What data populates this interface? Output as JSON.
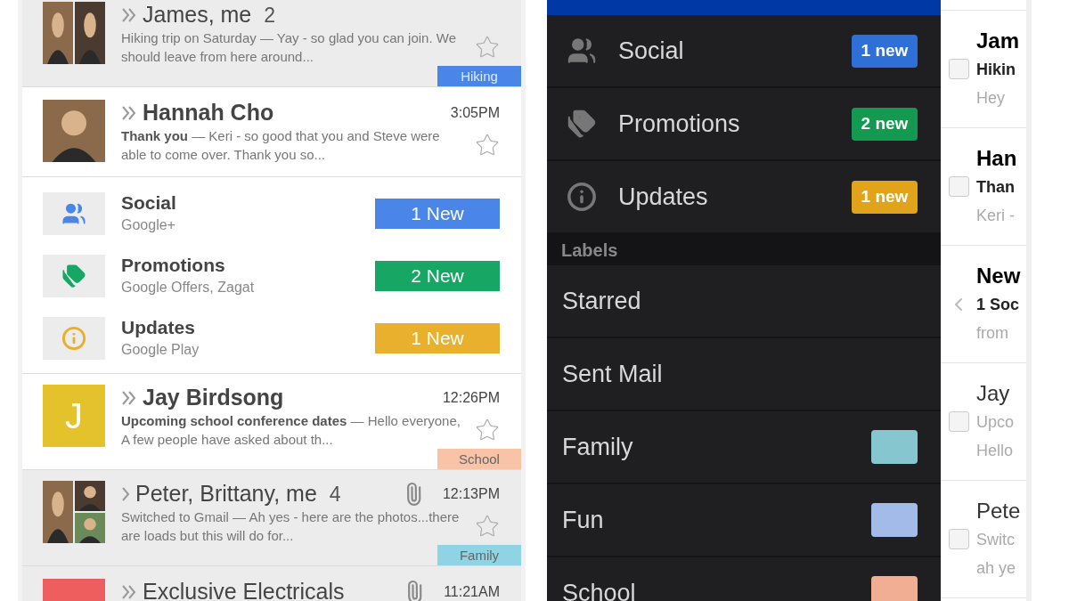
{
  "inbox": {
    "threads": [
      {
        "kind": "thread",
        "sender": "James, me",
        "count": "2",
        "unread": false,
        "important": true,
        "attachment": false,
        "avatar": {
          "kind": "photo_pair"
        },
        "preview": "Hiking trip on Saturday — Yay - so glad you can join. We should leave from here around...",
        "tag": {
          "label": "Hiking",
          "color": "#4a86e8"
        }
      },
      {
        "kind": "thread",
        "sender": "Hannah Cho",
        "time": "3:05PM",
        "unread": true,
        "important": true,
        "attachment": false,
        "preview": "**Thank you** — Keri - so good that you and Steve were able to come over. Thank you so..."
      },
      {
        "kind": "categories",
        "items": [
          {
            "title": "Social",
            "subtitle": "Google+",
            "badge": "1 New",
            "color": "#4a86e8"
          },
          {
            "title": "Promotions",
            "subtitle": "Google Offers, Zagat",
            "badge": "2 New",
            "color": "#16a765"
          },
          {
            "title": "Updates",
            "subtitle": "Google Play",
            "badge": "1 New",
            "color": "#e8b02c"
          }
        ]
      },
      {
        "kind": "thread",
        "sender": "Jay Birdsong",
        "time": "12:26PM",
        "unread": true,
        "important": true,
        "attachment": false,
        "avatar": {
          "kind": "letter",
          "letter": "J",
          "color": "#e4c22b"
        },
        "preview": "**Upcoming school conference dates** — Hello everyone, A few people have asked about th...",
        "tag": {
          "label": "School",
          "color": "#f9c3a8"
        }
      },
      {
        "kind": "thread",
        "sender": "Peter, Brittany, me",
        "count": "4",
        "time": "12:13PM",
        "unread": false,
        "important": false,
        "attachment": true,
        "avatar": {
          "kind": "photo_trio"
        },
        "preview": "Switched to Gmail — Ah yes - here are the photos...there are loads but this will do for...",
        "tag": {
          "label": "Family",
          "color": "#8fd4e4"
        }
      },
      {
        "kind": "thread",
        "sender": "Exclusive Electricals",
        "time": "11:21AM",
        "unread": false,
        "important": true,
        "attachment": true,
        "avatar": {
          "kind": "letter",
          "color": "#ee5e5e"
        }
      }
    ]
  },
  "drawer": {
    "categories": [
      {
        "label": "Social",
        "badge": "1 new",
        "color": "#2f6fd8"
      },
      {
        "label": "Promotions",
        "badge": "2 new",
        "color": "#149a50"
      },
      {
        "label": "Updates",
        "badge": "1 new",
        "color": "#e0a31a"
      }
    ],
    "labels_header": "Labels",
    "labels": [
      {
        "name": "Starred"
      },
      {
        "name": "Sent Mail"
      },
      {
        "name": "Family",
        "color": "#86c7cf"
      },
      {
        "name": "Fun",
        "color": "#a3bbe8"
      },
      {
        "name": "School",
        "color": "#f2ae93"
      }
    ]
  },
  "message_list": [
    {
      "kind": "checkbox",
      "checked": false,
      "unread": true,
      "title": "Jam",
      "line_1": "Hikin",
      "line_2": "Hey"
    },
    {
      "kind": "checkbox",
      "checked": false,
      "unread": true,
      "title": "Han",
      "line_1": "Than",
      "line_2": "Keri -"
    },
    {
      "kind": "back",
      "unread": true,
      "title": "New",
      "line_1": "1 Soc",
      "line_2": "from"
    },
    {
      "kind": "checkbox",
      "checked": false,
      "unread": false,
      "title": "Jay",
      "line_1": "Upco",
      "line_2": "Hello"
    },
    {
      "kind": "checkbox",
      "checked": false,
      "unread": false,
      "title": "Pete",
      "line_1": "Switc",
      "line_2": "ah ye"
    }
  ]
}
